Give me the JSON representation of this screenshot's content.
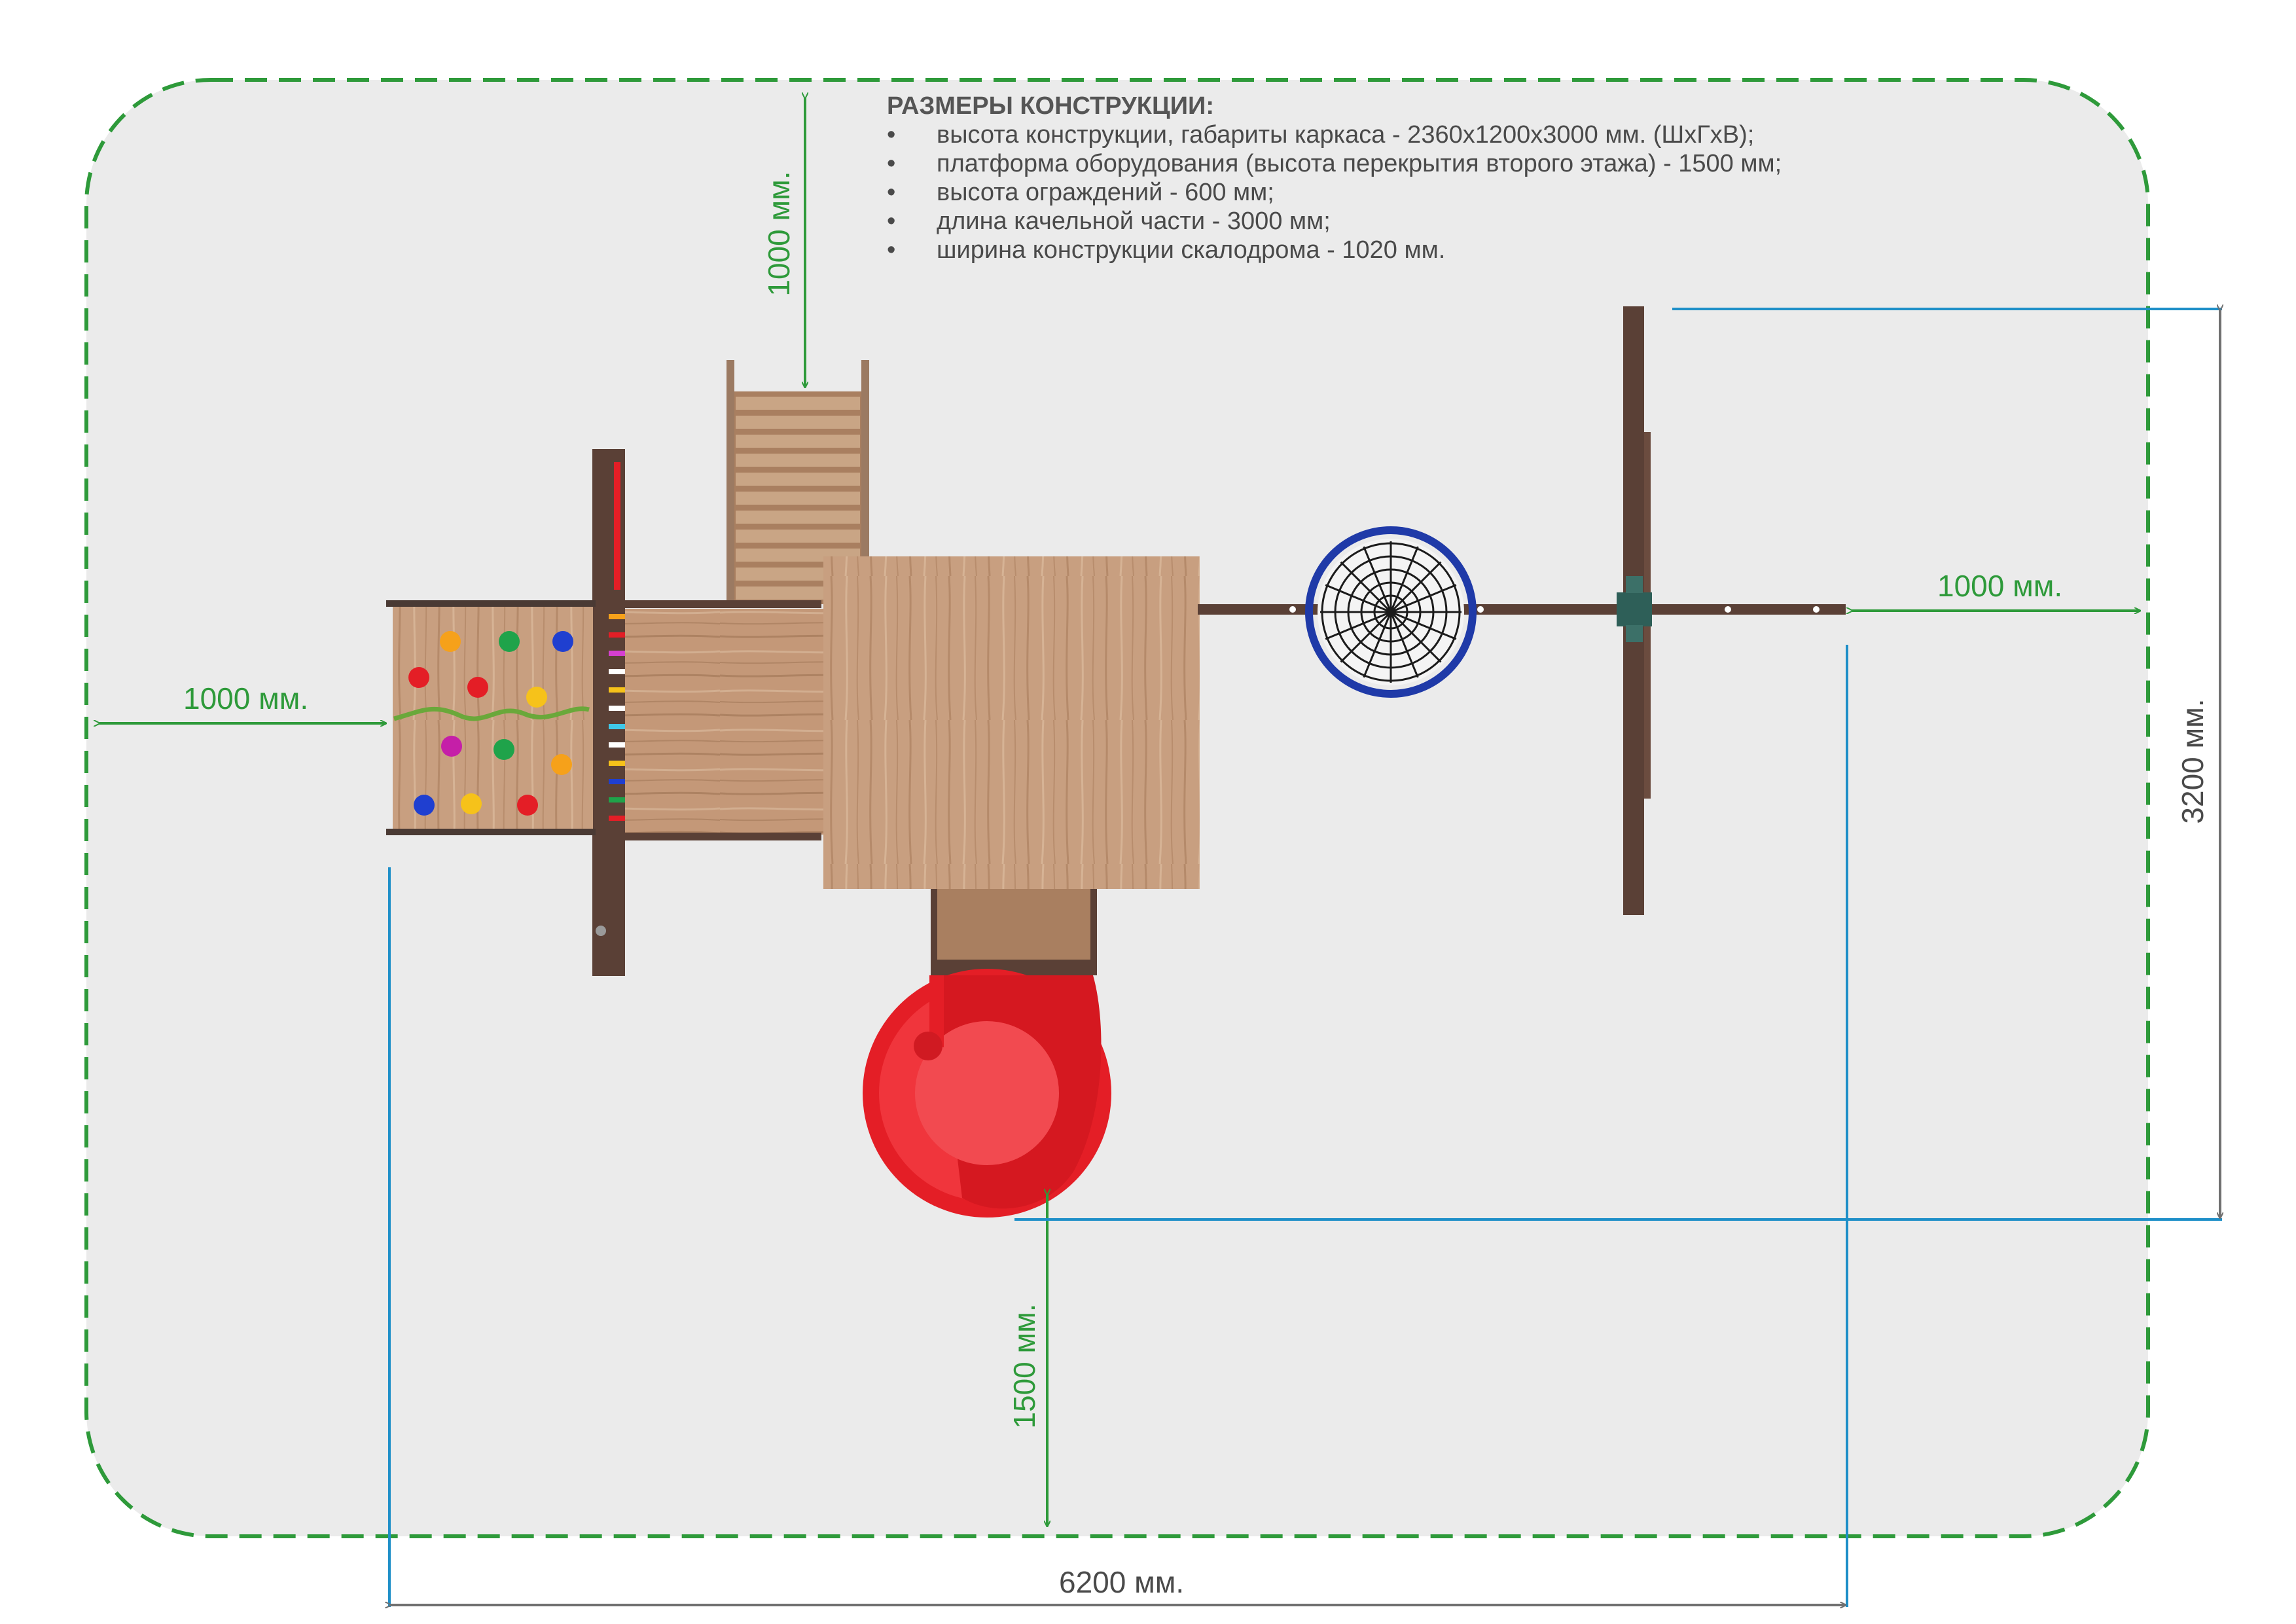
{
  "specs": {
    "title": "РАЗМЕРЫ КОНСТРУКЦИИ:",
    "items": [
      "высота конструкции, габариты каркаса - 2360х1200х3000 мм. (ШхГхВ);",
      "платформа оборудования (высота перекрытия второго этажа) - 1500 мм;",
      "высота ограждений - 600 мм;",
      "длина качельной части - 3000 мм;",
      "ширина конструкции скалодрома - 1020 мм."
    ]
  },
  "dimensions": {
    "top_clearance": "1000 мм.",
    "left_clearance": "1000 мм.",
    "right_clearance": "1000 мм.",
    "bottom_clearance": "1500 мм.",
    "total_width": "6200 мм.",
    "total_depth": "3200 мм."
  },
  "colors": {
    "zone_fill": "#ebebeb",
    "zone_border": "#2e9a3a",
    "dimension_green": "#2e9a3a",
    "extension_blue": "#1e8fc8",
    "dimension_grey": "#707070",
    "wood": "#c49a78",
    "dark_wood": "#5a4036",
    "slide_red": "#e41e26"
  }
}
